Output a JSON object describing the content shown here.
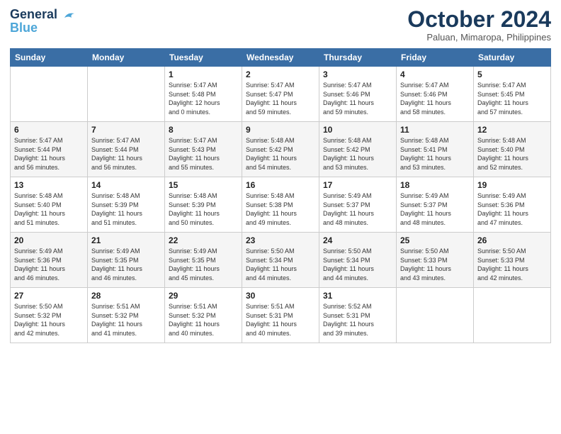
{
  "logo": {
    "line1": "General",
    "line2": "Blue",
    "bird": "▶"
  },
  "title": "October 2024",
  "subtitle": "Paluan, Mimaropa, Philippines",
  "headers": [
    "Sunday",
    "Monday",
    "Tuesday",
    "Wednesday",
    "Thursday",
    "Friday",
    "Saturday"
  ],
  "weeks": [
    [
      {
        "day": "",
        "info": ""
      },
      {
        "day": "",
        "info": ""
      },
      {
        "day": "1",
        "info": "Sunrise: 5:47 AM\nSunset: 5:48 PM\nDaylight: 12 hours\nand 0 minutes."
      },
      {
        "day": "2",
        "info": "Sunrise: 5:47 AM\nSunset: 5:47 PM\nDaylight: 11 hours\nand 59 minutes."
      },
      {
        "day": "3",
        "info": "Sunrise: 5:47 AM\nSunset: 5:46 PM\nDaylight: 11 hours\nand 59 minutes."
      },
      {
        "day": "4",
        "info": "Sunrise: 5:47 AM\nSunset: 5:46 PM\nDaylight: 11 hours\nand 58 minutes."
      },
      {
        "day": "5",
        "info": "Sunrise: 5:47 AM\nSunset: 5:45 PM\nDaylight: 11 hours\nand 57 minutes."
      }
    ],
    [
      {
        "day": "6",
        "info": "Sunrise: 5:47 AM\nSunset: 5:44 PM\nDaylight: 11 hours\nand 56 minutes."
      },
      {
        "day": "7",
        "info": "Sunrise: 5:47 AM\nSunset: 5:44 PM\nDaylight: 11 hours\nand 56 minutes."
      },
      {
        "day": "8",
        "info": "Sunrise: 5:47 AM\nSunset: 5:43 PM\nDaylight: 11 hours\nand 55 minutes."
      },
      {
        "day": "9",
        "info": "Sunrise: 5:48 AM\nSunset: 5:42 PM\nDaylight: 11 hours\nand 54 minutes."
      },
      {
        "day": "10",
        "info": "Sunrise: 5:48 AM\nSunset: 5:42 PM\nDaylight: 11 hours\nand 53 minutes."
      },
      {
        "day": "11",
        "info": "Sunrise: 5:48 AM\nSunset: 5:41 PM\nDaylight: 11 hours\nand 53 minutes."
      },
      {
        "day": "12",
        "info": "Sunrise: 5:48 AM\nSunset: 5:40 PM\nDaylight: 11 hours\nand 52 minutes."
      }
    ],
    [
      {
        "day": "13",
        "info": "Sunrise: 5:48 AM\nSunset: 5:40 PM\nDaylight: 11 hours\nand 51 minutes."
      },
      {
        "day": "14",
        "info": "Sunrise: 5:48 AM\nSunset: 5:39 PM\nDaylight: 11 hours\nand 51 minutes."
      },
      {
        "day": "15",
        "info": "Sunrise: 5:48 AM\nSunset: 5:39 PM\nDaylight: 11 hours\nand 50 minutes."
      },
      {
        "day": "16",
        "info": "Sunrise: 5:48 AM\nSunset: 5:38 PM\nDaylight: 11 hours\nand 49 minutes."
      },
      {
        "day": "17",
        "info": "Sunrise: 5:49 AM\nSunset: 5:37 PM\nDaylight: 11 hours\nand 48 minutes."
      },
      {
        "day": "18",
        "info": "Sunrise: 5:49 AM\nSunset: 5:37 PM\nDaylight: 11 hours\nand 48 minutes."
      },
      {
        "day": "19",
        "info": "Sunrise: 5:49 AM\nSunset: 5:36 PM\nDaylight: 11 hours\nand 47 minutes."
      }
    ],
    [
      {
        "day": "20",
        "info": "Sunrise: 5:49 AM\nSunset: 5:36 PM\nDaylight: 11 hours\nand 46 minutes."
      },
      {
        "day": "21",
        "info": "Sunrise: 5:49 AM\nSunset: 5:35 PM\nDaylight: 11 hours\nand 46 minutes."
      },
      {
        "day": "22",
        "info": "Sunrise: 5:49 AM\nSunset: 5:35 PM\nDaylight: 11 hours\nand 45 minutes."
      },
      {
        "day": "23",
        "info": "Sunrise: 5:50 AM\nSunset: 5:34 PM\nDaylight: 11 hours\nand 44 minutes."
      },
      {
        "day": "24",
        "info": "Sunrise: 5:50 AM\nSunset: 5:34 PM\nDaylight: 11 hours\nand 44 minutes."
      },
      {
        "day": "25",
        "info": "Sunrise: 5:50 AM\nSunset: 5:33 PM\nDaylight: 11 hours\nand 43 minutes."
      },
      {
        "day": "26",
        "info": "Sunrise: 5:50 AM\nSunset: 5:33 PM\nDaylight: 11 hours\nand 42 minutes."
      }
    ],
    [
      {
        "day": "27",
        "info": "Sunrise: 5:50 AM\nSunset: 5:32 PM\nDaylight: 11 hours\nand 42 minutes."
      },
      {
        "day": "28",
        "info": "Sunrise: 5:51 AM\nSunset: 5:32 PM\nDaylight: 11 hours\nand 41 minutes."
      },
      {
        "day": "29",
        "info": "Sunrise: 5:51 AM\nSunset: 5:32 PM\nDaylight: 11 hours\nand 40 minutes."
      },
      {
        "day": "30",
        "info": "Sunrise: 5:51 AM\nSunset: 5:31 PM\nDaylight: 11 hours\nand 40 minutes."
      },
      {
        "day": "31",
        "info": "Sunrise: 5:52 AM\nSunset: 5:31 PM\nDaylight: 11 hours\nand 39 minutes."
      },
      {
        "day": "",
        "info": ""
      },
      {
        "day": "",
        "info": ""
      }
    ]
  ]
}
